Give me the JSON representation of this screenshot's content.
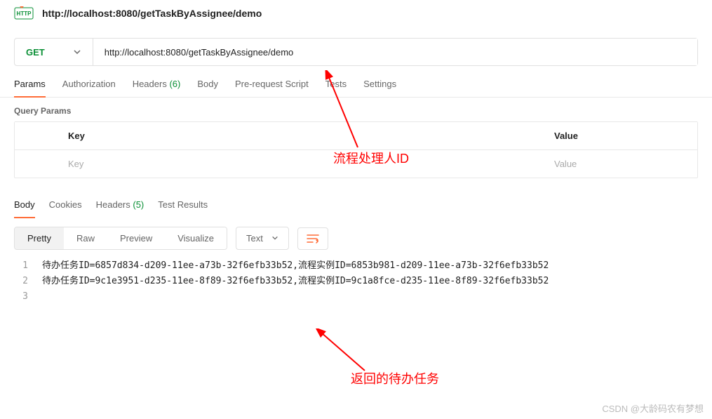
{
  "header": {
    "url": "http://localhost:8080/getTaskByAssignee/demo"
  },
  "request": {
    "method": "GET",
    "url": "http://localhost:8080/getTaskByAssignee/demo"
  },
  "tabs": {
    "params": "Params",
    "authorization": "Authorization",
    "headers": "Headers",
    "headers_count": "(6)",
    "body": "Body",
    "prerequest": "Pre-request Script",
    "tests": "Tests",
    "settings": "Settings"
  },
  "query_params": {
    "label": "Query Params",
    "key_header": "Key",
    "value_header": "Value",
    "key_placeholder": "Key",
    "value_placeholder": "Value"
  },
  "response_tabs": {
    "body": "Body",
    "cookies": "Cookies",
    "headers": "Headers",
    "headers_count": "(5)",
    "test_results": "Test Results"
  },
  "response_toolbar": {
    "pretty": "Pretty",
    "raw": "Raw",
    "preview": "Preview",
    "visualize": "Visualize",
    "format": "Text"
  },
  "response_lines": [
    "待办任务ID=6857d834-d209-11ee-a73b-32f6efb33b52,流程实例ID=6853b981-d209-11ee-a73b-32f6efb33b52",
    "待办任务ID=9c1e3951-d235-11ee-8f89-32f6efb33b52,流程实例ID=9c1a8fce-d235-11ee-8f89-32f6efb33b52",
    ""
  ],
  "annotations": {
    "top": "流程处理人ID",
    "bottom": "返回的待办任务"
  },
  "watermark": "CSDN @大龄码农有梦想"
}
